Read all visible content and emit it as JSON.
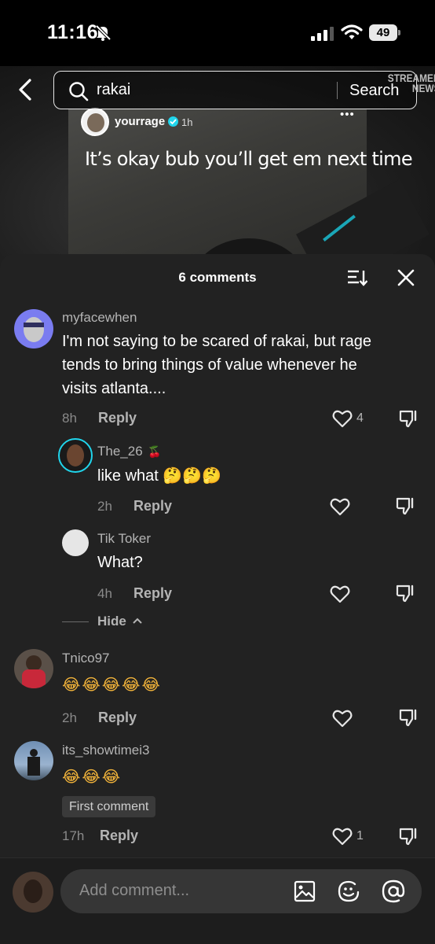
{
  "status_bar": {
    "time": "11:16",
    "battery": "49"
  },
  "post": {
    "username": "yourrage",
    "time": "1h",
    "more": "•••",
    "caption": "It’s okay bub you’ll get em next time"
  },
  "search": {
    "query": "rakai",
    "button_label": "Search"
  },
  "watermark": {
    "line1": "STREAMER",
    "line2": "NEWS"
  },
  "sheet": {
    "title": "6 comments"
  },
  "comments": [
    {
      "username": "myfacewhen",
      "lines": [
        "I'm not saying to be scared of rakai, but rage",
        "tends to bring things of value whenever he",
        "visits atlanta...."
      ],
      "time": "8h",
      "reply": "Reply",
      "likes": "4"
    },
    {
      "username": "The_26",
      "emoji_suffix": "🍒",
      "text": "like what",
      "emojis": "🤔🤔🤔",
      "time": "2h",
      "reply": "Reply"
    },
    {
      "username": "Tik Toker",
      "text": "What?",
      "time": "4h",
      "reply": "Reply"
    },
    {
      "username": "Tnico97",
      "text": "😂😂😂😂😂",
      "time": "2h",
      "reply": "Reply"
    },
    {
      "username": "its_showtimei3",
      "text": "😂😂😂",
      "badge": "First comment",
      "time": "17h",
      "reply": "Reply",
      "likes": "1"
    }
  ],
  "hide": {
    "label": "Hide"
  },
  "composer": {
    "placeholder": "Add comment..."
  },
  "colors": {
    "sheet_bg": "#222222",
    "muted": "#b4b4b4",
    "avatar_ring": "#20d5ec"
  }
}
